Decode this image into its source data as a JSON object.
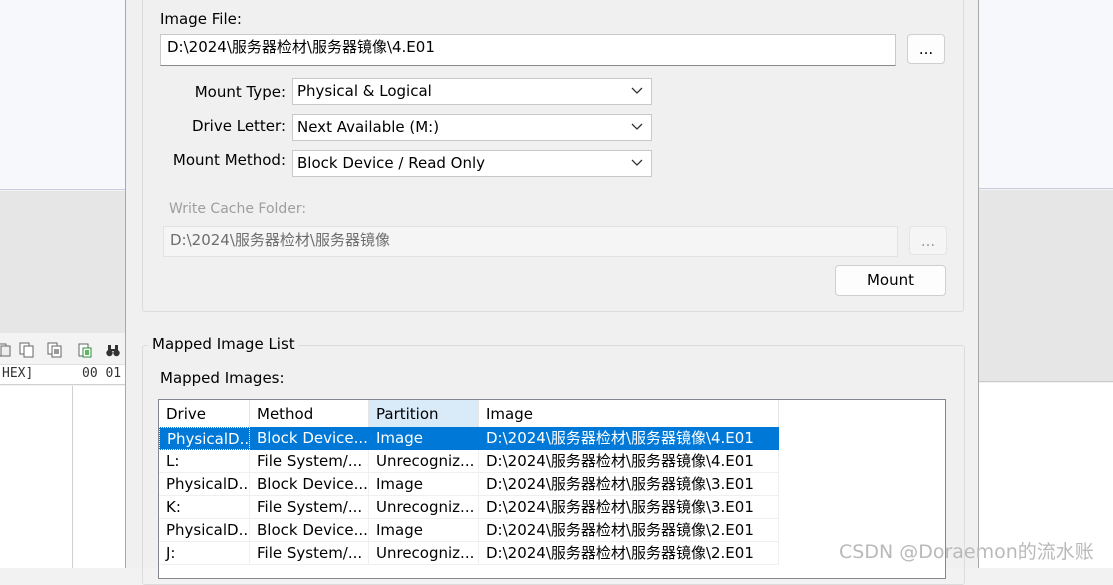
{
  "background_app": {
    "hex_column_label": "HEX]",
    "hex_offset": "00 01"
  },
  "image_file": {
    "label": "Image File:",
    "value": "D:\\2024\\服务器检材\\服务器镜像\\4.E01",
    "browse_label": "..."
  },
  "mount_type": {
    "label": "Mount Type:",
    "value": "Physical & Logical"
  },
  "drive_letter": {
    "label": "Drive Letter:",
    "value": "Next Available (M:)"
  },
  "mount_method": {
    "label": "Mount Method:",
    "value": "Block Device / Read Only"
  },
  "write_cache": {
    "label": "Write Cache Folder:",
    "value": "D:\\2024\\服务器检材\\服务器镜像",
    "browse_label": "..."
  },
  "mount_button": "Mount",
  "mapped_list": {
    "group_title": "Mapped Image List",
    "label": "Mapped Images:",
    "columns": [
      "Drive",
      "Method",
      "Partition",
      "Image"
    ],
    "rows": [
      [
        "PhysicalD...",
        "Block Device...",
        "Image",
        "D:\\2024\\服务器检材\\服务器镜像\\4.E01"
      ],
      [
        "L:",
        "File System/...",
        "Unrecogniz...",
        "D:\\2024\\服务器检材\\服务器镜像\\4.E01"
      ],
      [
        "PhysicalD...",
        "Block Device...",
        "Image",
        "D:\\2024\\服务器检材\\服务器镜像\\3.E01"
      ],
      [
        "K:",
        "File System/...",
        "Unrecogniz...",
        "D:\\2024\\服务器检材\\服务器镜像\\3.E01"
      ],
      [
        "PhysicalD...",
        "Block Device...",
        "Image",
        "D:\\2024\\服务器检材\\服务器镜像\\2.E01"
      ],
      [
        "J:",
        "File System/...",
        "Unrecogniz...",
        "D:\\2024\\服务器检材\\服务器镜像\\2.E01"
      ]
    ],
    "selected_row": 0
  },
  "watermark": "CSDN @Doraemon的流水账",
  "colors": {
    "selection": "#0078d7",
    "sorted_header": "#d9ebf9",
    "dialog_bg": "#f0f0f0"
  }
}
